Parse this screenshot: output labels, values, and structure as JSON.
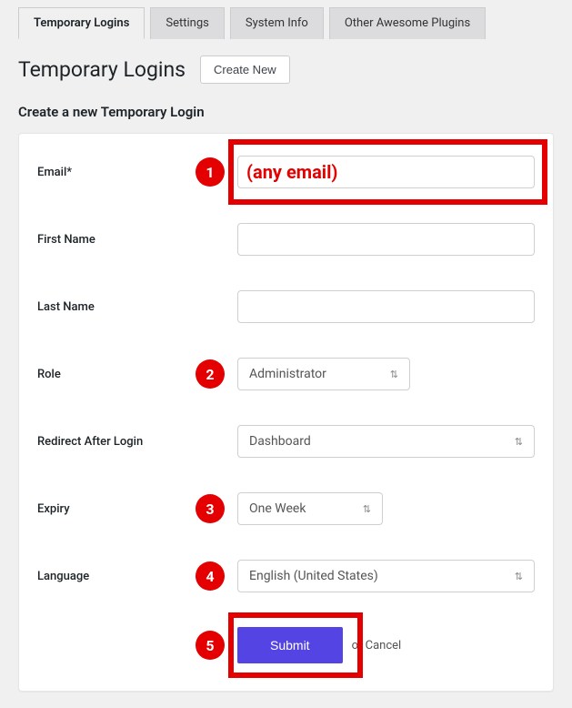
{
  "tabs": [
    {
      "label": "Temporary Logins"
    },
    {
      "label": "Settings"
    },
    {
      "label": "System Info"
    },
    {
      "label": "Other Awesome Plugins"
    }
  ],
  "page": {
    "title": "Temporary Logins",
    "create_button": "Create New",
    "sub_heading": "Create a new Temporary Login"
  },
  "form": {
    "email": {
      "label": "Email*",
      "value": "",
      "annotation_text": "(any email)"
    },
    "first_name": {
      "label": "First Name",
      "value": ""
    },
    "last_name": {
      "label": "Last Name",
      "value": ""
    },
    "role": {
      "label": "Role",
      "value": "Administrator"
    },
    "redirect": {
      "label": "Redirect After Login",
      "value": "Dashboard"
    },
    "expiry": {
      "label": "Expiry",
      "value": "One Week"
    },
    "language": {
      "label": "Language",
      "value": "English (United States)"
    },
    "submit": {
      "label": "Submit",
      "or_text": "or ",
      "cancel": "Cancel"
    }
  },
  "callouts": {
    "c1": "1",
    "c2": "2",
    "c3": "3",
    "c4": "4",
    "c5": "5"
  }
}
